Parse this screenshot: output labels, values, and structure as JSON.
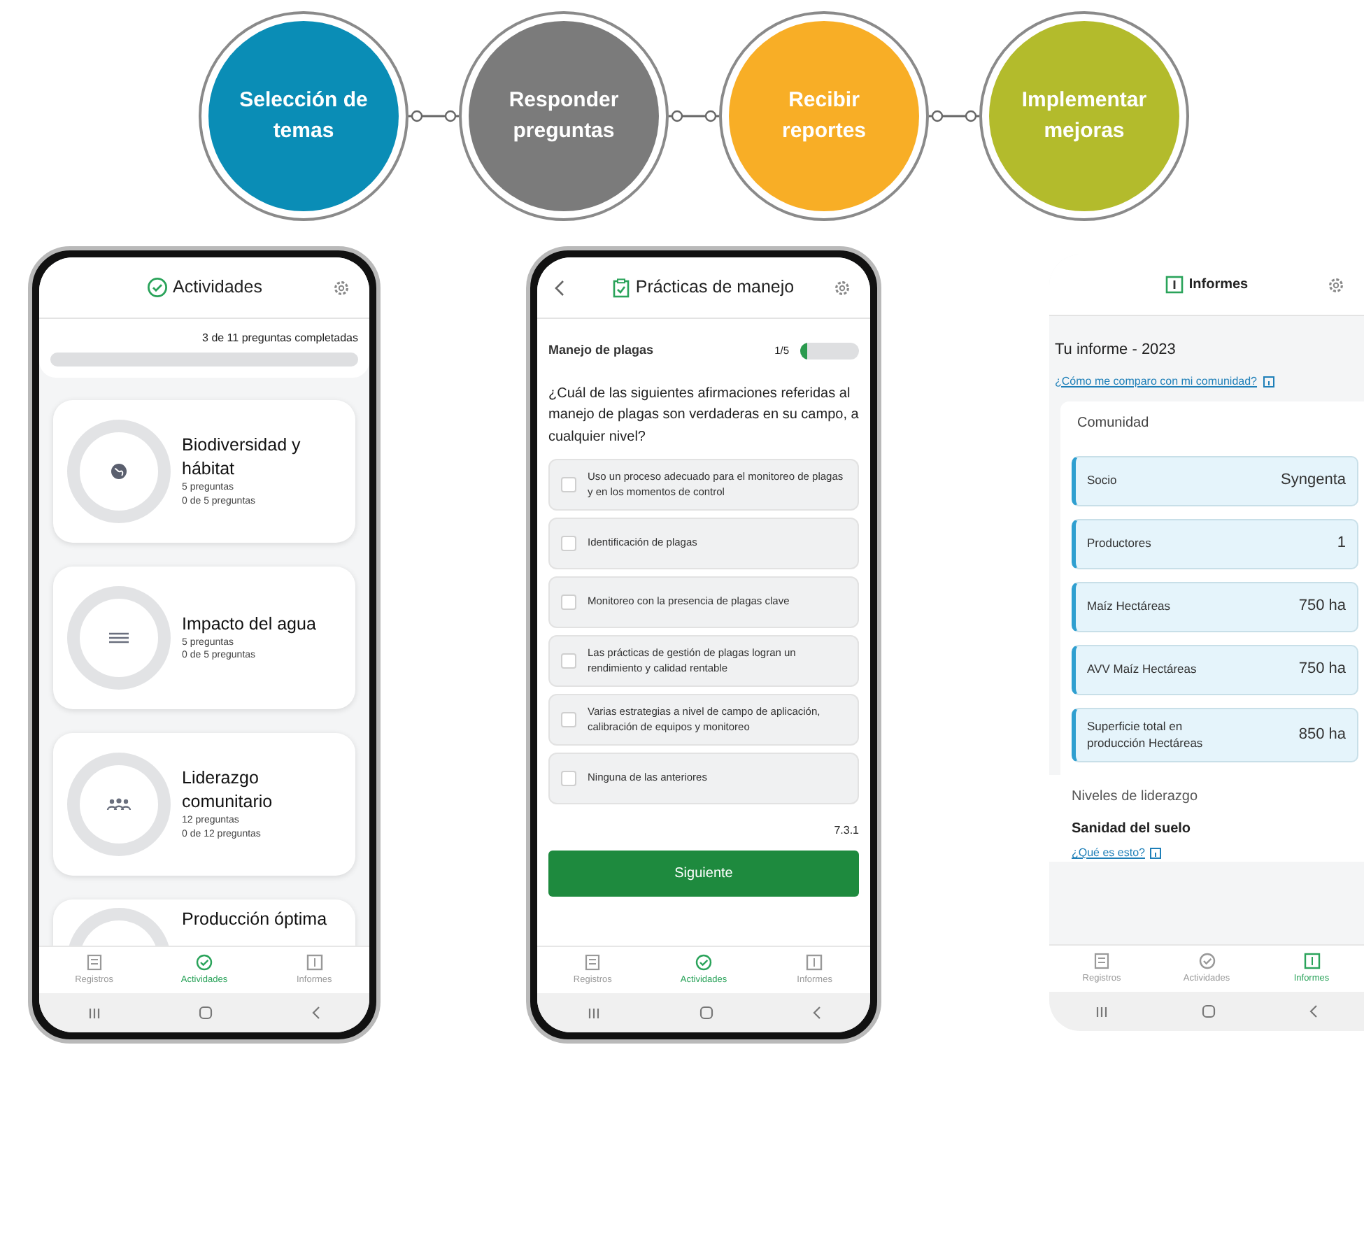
{
  "steps": [
    {
      "label": "Selección de temas",
      "color": "#0a8db6"
    },
    {
      "label": "Responder preguntas",
      "color": "#7b7b7b"
    },
    {
      "label": "Recibir reportes",
      "color": "#f8ae26"
    },
    {
      "label": "Implementar mejoras",
      "color": "#b3bb2c"
    }
  ],
  "phones": [
    {
      "kind": "activities",
      "header": {
        "title": "Actividades"
      },
      "progress_text": "3 de 11 preguntas completadas",
      "level": 0,
      "cards": [
        {
          "title": "Biodiversidad y hábitat",
          "questions": "5 preguntas",
          "done": "0 de 5 preguntas"
        },
        {
          "title": "Impacto del agua",
          "questions": "5 preguntas",
          "done": "0 de 5 preguntas"
        },
        {
          "title": "Liderazgo comunitario",
          "questions": "12 preguntas",
          "done": "0 de 12 preguntas"
        },
        {
          "title": "Producción óptima"
        }
      ],
      "nav": [
        {
          "label": "Registros",
          "selected": false
        },
        {
          "label": "Actividades",
          "selected": true
        },
        {
          "label": "Informes",
          "selected": false
        }
      ]
    },
    {
      "kind": "question",
      "header": {
        "title": "Prácticas de manejo"
      },
      "section": "Manejo de plagas",
      "count": "1/5",
      "level": 0.12,
      "question": "¿Cuál de las siguientes afirmaciones referidas al manejo de plagas son verdaderas en su campo, a cualquier nivel?",
      "options": [
        {
          "text": "Uso un proceso adecuado para el monitoreo de plagas y en los momentos de control",
          "checked": false
        },
        {
          "text": "Identificación de plagas",
          "checked": false
        },
        {
          "text": "Monitoreo con la presencia de plagas clave",
          "checked": false
        },
        {
          "text": "Las prácticas de gestión de plagas logran un rendimiento y calidad rentable",
          "checked": false
        },
        {
          "text": "Varias estrategias a nivel de campo de aplicación, calibración de equipos y monitoreo",
          "checked": false
        },
        {
          "text": "Ninguna de las anteriores",
          "checked": false
        }
      ],
      "code": "7.3.1",
      "button": "Siguiente",
      "nav": [
        {
          "label": "Registros",
          "selected": false
        },
        {
          "label": "Actividades",
          "selected": true
        },
        {
          "label": "Informes",
          "selected": false
        }
      ]
    },
    {
      "kind": "report",
      "header": {
        "title": "Informes"
      },
      "report_title": "Tu informe - 2023",
      "compare_link": "¿Cómo me comparo con mi comunidad?",
      "section": "Comunidad",
      "rows": [
        {
          "label": "Socio",
          "value": "Syngenta"
        },
        {
          "label": "Productores",
          "value": "1"
        },
        {
          "label": "Maíz Hectáreas",
          "value": "750 ha"
        },
        {
          "label": "AVV Maíz Hectáreas",
          "value": "750 ha"
        },
        {
          "label": "Superficie total en producción Hectáreas",
          "value": "850 ha"
        }
      ],
      "levels_title": "Niveles de liderazgo",
      "topic": "Sanidad del suelo",
      "topic_link": "¿Qué es esto?",
      "nav": [
        {
          "label": "Registros",
          "selected": false
        },
        {
          "label": "Actividades",
          "selected": false
        },
        {
          "label": "Informes",
          "selected": true
        }
      ]
    }
  ]
}
